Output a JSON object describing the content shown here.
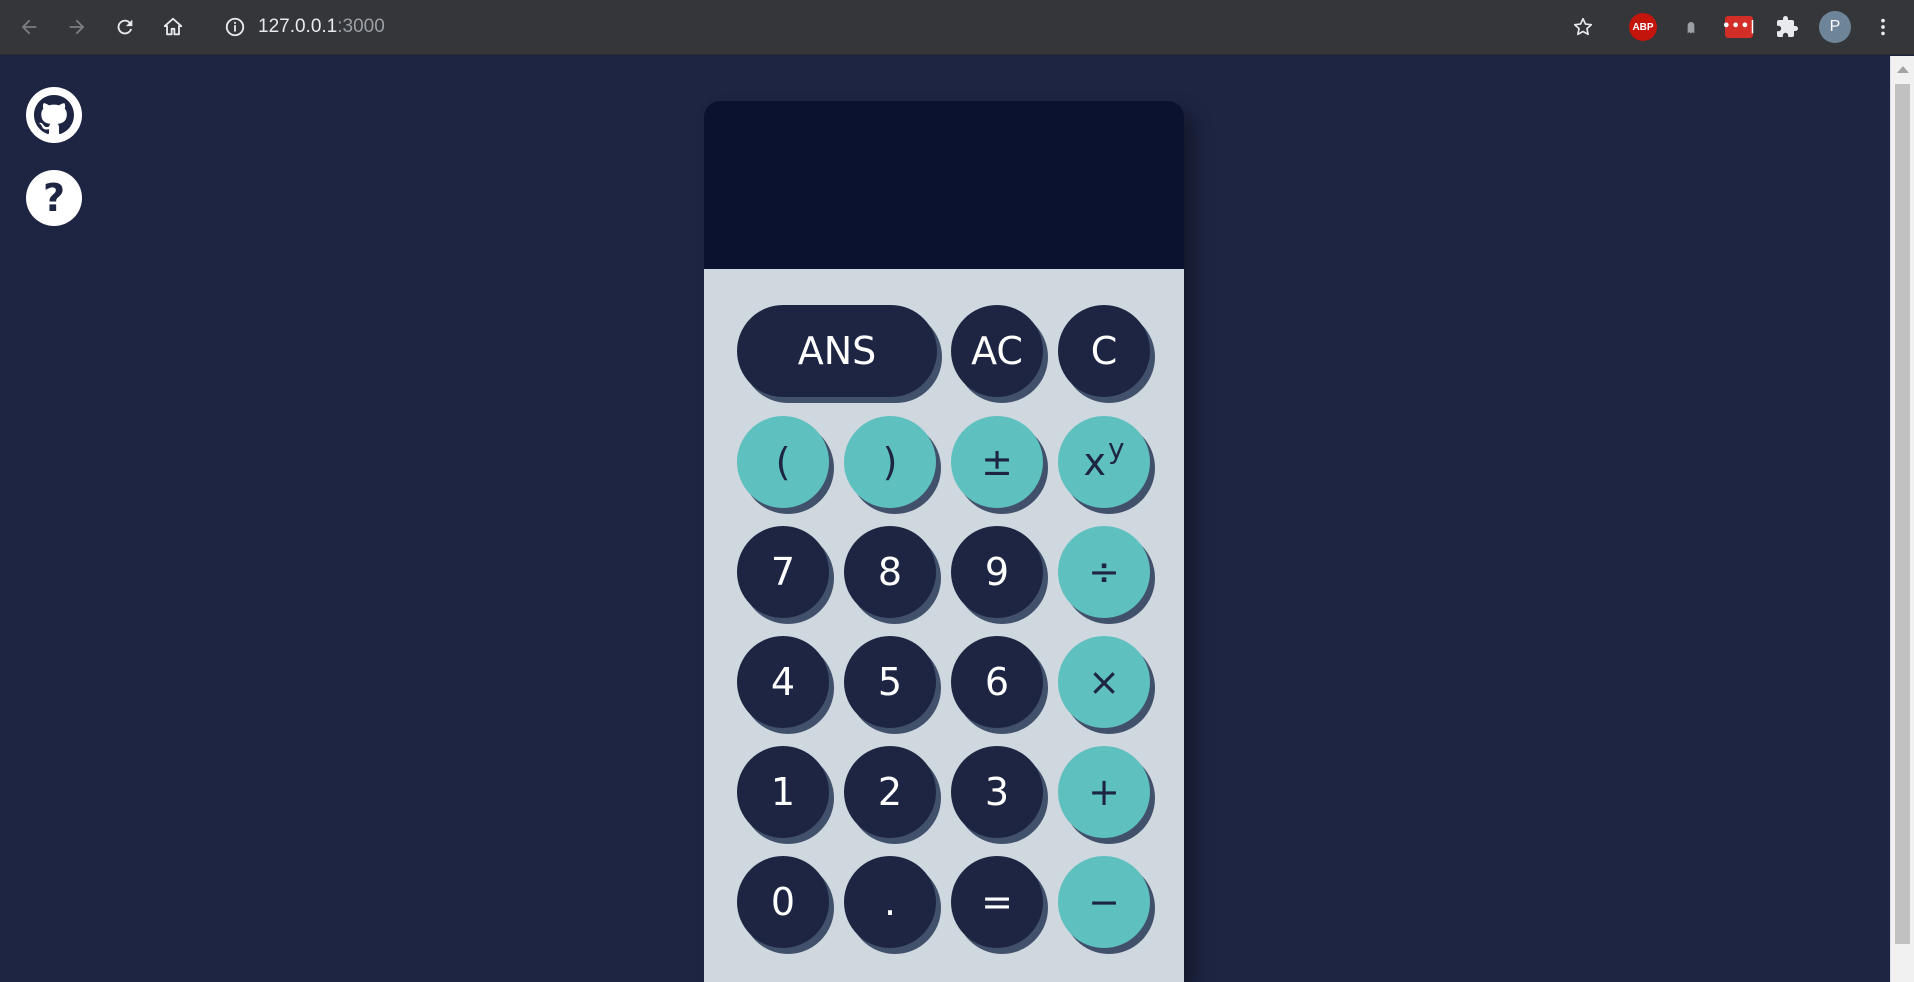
{
  "browser": {
    "url_host": "127.0.0.1",
    "url_port": ":3000",
    "ext_abp_label": "ABP",
    "ext_lastpass_label": "•••|",
    "profile_initial": "P"
  },
  "sidebar": {
    "github_icon": "github-icon",
    "help_icon": "help-icon",
    "help_glyph": "?"
  },
  "calculator": {
    "display_value": "",
    "keys": {
      "ans": "ANS",
      "ac": "AC",
      "c": "C",
      "lparen": "(",
      "rparen": ")",
      "plusminus": "±",
      "pow_base": "x",
      "pow_exp": "y",
      "k7": "7",
      "k8": "8",
      "k9": "9",
      "divide": "÷",
      "k4": "4",
      "k5": "5",
      "k6": "6",
      "multiply": "×",
      "k1": "1",
      "k2": "2",
      "k3": "3",
      "plus": "+",
      "k0": "0",
      "dot": ".",
      "equals": "=",
      "minus": "−"
    },
    "colors": {
      "background": "#1e2543",
      "display": "#0b1230",
      "keypad": "#cfd7df",
      "dark_key": "#1e2543",
      "teal_key": "#5ec0bf",
      "key_shadow": "#41516b"
    }
  }
}
